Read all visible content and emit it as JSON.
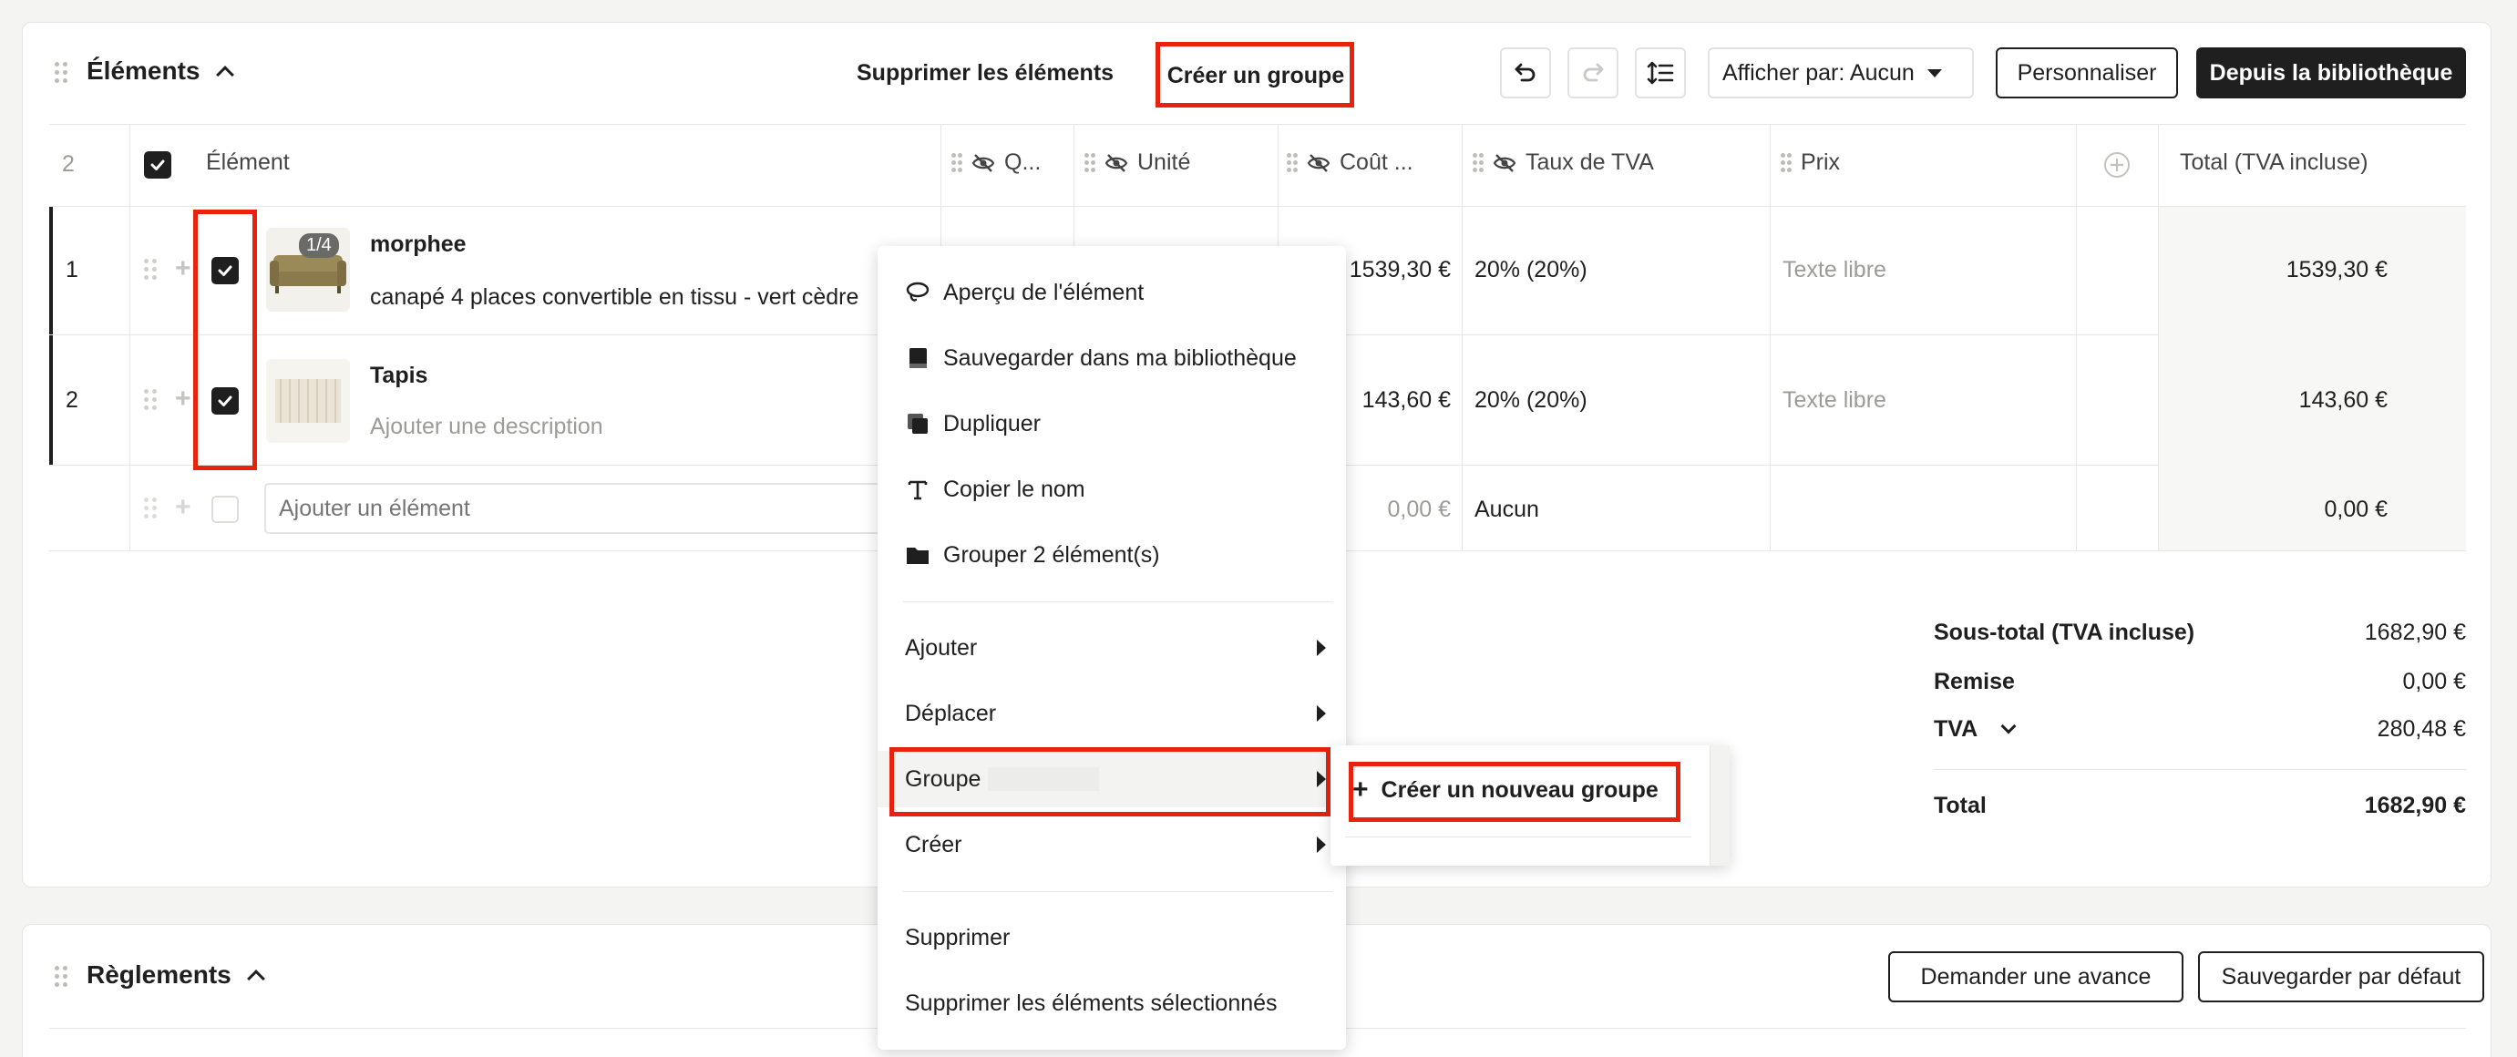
{
  "elements_section": {
    "title": "Éléments",
    "delete_elements": "Supprimer les éléments",
    "create_group": "Créer un groupe",
    "display_by": "Afficher par: Aucun",
    "customize": "Personnaliser",
    "from_library": "Depuis la bibliothèque"
  },
  "table": {
    "selected_count": "2",
    "headers": {
      "element": "Élément",
      "quantity": "Q...",
      "unit": "Unité",
      "cost": "Coût ...",
      "vat_rate": "Taux de TVA",
      "price": "Prix",
      "total": "Total (TVA incluse)"
    },
    "rows": [
      {
        "index": "1",
        "name": "morphee",
        "description": "canapé 4 places convertible en tissu - vert cèdre",
        "image_badge": "1/4",
        "cost": "1539,30 €",
        "vat": "20% (20%)",
        "price": "Texte libre",
        "total": "1539,30 €"
      },
      {
        "index": "2",
        "name": "Tapis",
        "description": "Ajouter une description",
        "cost": "143,60 €",
        "vat": "20% (20%)",
        "price": "Texte libre",
        "total": "143,60 €"
      }
    ],
    "new_row": {
      "placeholder": "Ajouter un élément",
      "cost": "0,00 €",
      "vat": "Aucun",
      "total": "0,00 €"
    }
  },
  "totals": {
    "subtotal_label": "Sous-total (TVA incluse)",
    "subtotal_value": "1682,90 €",
    "discount_label": "Remise",
    "discount_value": "0,00 €",
    "vat_label": "TVA",
    "vat_value": "280,48 €",
    "total_label": "Total",
    "total_value": "1682,90 €"
  },
  "context_menu": {
    "preview": "Aperçu de l'élément",
    "save_library": "Sauvegarder dans ma bibliothèque",
    "duplicate": "Dupliquer",
    "copy_name": "Copier le nom",
    "group_items": "Grouper 2 élément(s)",
    "add": "Ajouter",
    "move": "Déplacer",
    "group": "Groupe",
    "create": "Créer",
    "delete": "Supprimer",
    "delete_selected": "Supprimer les éléments sélectionnés"
  },
  "submenu": {
    "new_group": "Créer un nouveau groupe"
  },
  "reglements_section": {
    "title": "Règlements",
    "request_advance": "Demander une avance",
    "save_default": "Sauvegarder par défaut"
  },
  "colors": {
    "accent_dark": "#1f1f1f",
    "highlight_red": "#e8230d",
    "muted_text": "#9b9b97"
  }
}
